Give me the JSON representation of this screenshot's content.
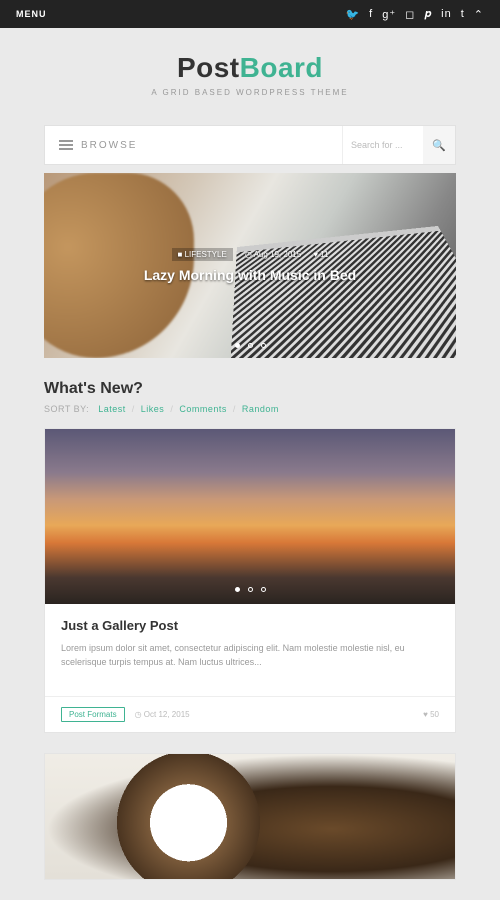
{
  "topbar": {
    "menu": "MENU"
  },
  "logo": {
    "a": "Post",
    "b": "Board"
  },
  "tagline": "A GRID BASED WORDPRESS THEME",
  "browse": {
    "label": "BROWSE"
  },
  "search": {
    "placeholder": "Search for ..."
  },
  "hero": {
    "category": "LIFESTYLE",
    "date": "Aug 19, 2015",
    "likes": "11",
    "title": "Lazy Morning with Music in Bed"
  },
  "section": {
    "title": "What's New?"
  },
  "sort": {
    "label": "SORT BY:",
    "options": [
      "Latest",
      "Likes",
      "Comments",
      "Random"
    ]
  },
  "card1": {
    "title": "Just a Gallery Post",
    "text": "Lorem ipsum dolor sit amet, consectetur adipiscing elit. Nam molestie molestie nisl, eu scelerisque turpis tempus at. Nam luctus ultrices...",
    "tag": "Post Formats",
    "date": "Oct 12, 2015",
    "likes": "50"
  }
}
